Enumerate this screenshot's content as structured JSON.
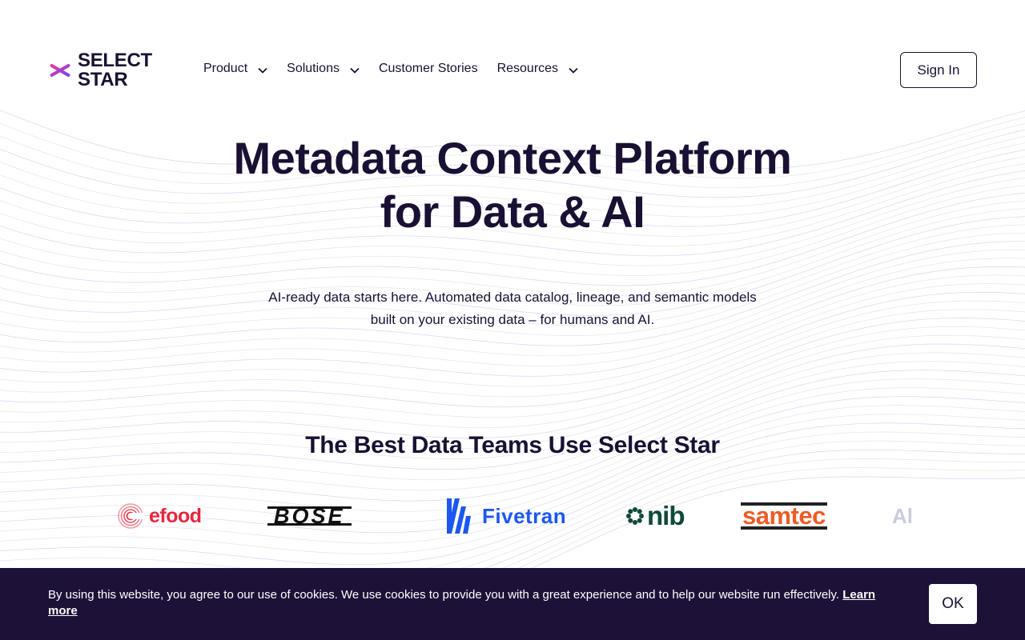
{
  "brand": {
    "line1": "SELECT",
    "line2": "STAR"
  },
  "nav": {
    "items": [
      {
        "label": "Product",
        "has_dropdown": true
      },
      {
        "label": "Solutions",
        "has_dropdown": true
      },
      {
        "label": "Customer Stories",
        "has_dropdown": false
      },
      {
        "label": "Resources",
        "has_dropdown": true
      }
    ],
    "signin_label": "Sign In"
  },
  "hero": {
    "title_line1": "Metadata Context Platform",
    "title_line2": "for Data & AI",
    "subtitle_line1": "AI-ready data starts here. Automated data catalog, lineage, and semantic models",
    "subtitle_line2": "built on your existing data – for humans and AI."
  },
  "customers": {
    "title": "The Best Data Teams Use Select Star",
    "logos": [
      "efood",
      "BOSE",
      "Fivetran",
      "nib",
      "samtec",
      "Al"
    ]
  },
  "cookie": {
    "text": "By using this website, you agree to our use of cookies. We use cookies to provide you with a great experience and to help our website run effectively.",
    "link_label": "Learn more",
    "ok_label": "OK"
  },
  "colors": {
    "navy": "#1a1033",
    "banner_bg": "#1e1137",
    "brand_pink": "#e6399b",
    "brand_purple": "#7b3ff2",
    "efood_red": "#e8263c",
    "fivetran_blue": "#1b57f0",
    "nib_green": "#0f4a3a",
    "samtec_orange": "#ef5b24"
  },
  "icons": {
    "logo": "asterisk-star-icon",
    "dropdown": "chevron-down-icon"
  }
}
